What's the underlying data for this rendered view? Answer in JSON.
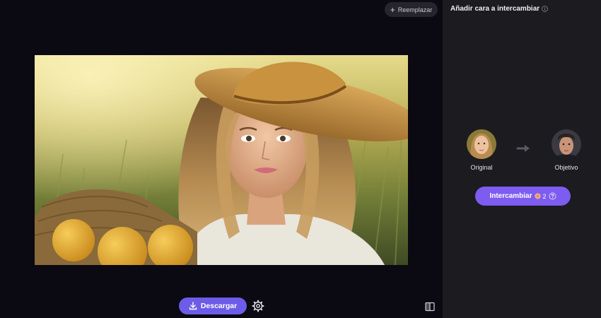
{
  "toolbar": {
    "replace_label": "Reemplazar",
    "replace_icon": "plus-icon"
  },
  "image": {
    "description_icon": "photo-woman-straw-hat-basket-oranges"
  },
  "bottom": {
    "download_label": "Descargar",
    "download_icon": "download-icon",
    "settings_icon": "gear-icon",
    "compare_icon": "split-view-icon"
  },
  "panel": {
    "title": "Añadir cara a intercambiar",
    "title_icon": "info-icon",
    "original_label": "Original",
    "target_label": "Objetivo",
    "arrow_icon": "arrow-right-icon",
    "swap_label": "Intercambiar",
    "swap_credits": "2",
    "swap_help_icon": "question-icon"
  },
  "colors": {
    "accent": "#7d5cf0",
    "download_accent": "#6c5ce7",
    "panel_bg": "#1c1b20",
    "workspace_bg": "#0b0912"
  }
}
